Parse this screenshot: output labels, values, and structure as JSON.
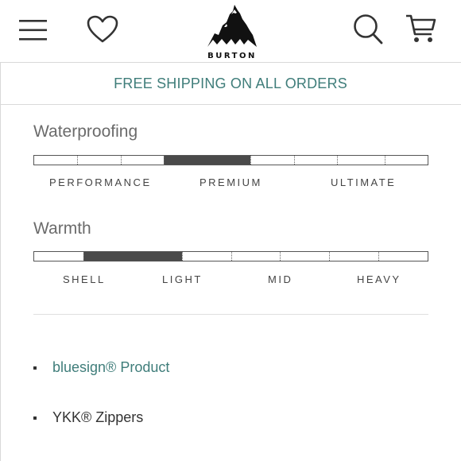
{
  "header": {
    "brand": "BURTON",
    "icons": [
      "menu-icon",
      "heart-icon",
      "burton-mountain-logo",
      "search-icon",
      "cart-icon"
    ]
  },
  "promo": {
    "text": "FREE SHIPPING ON ALL ORDERS",
    "color": "#3f7d7a"
  },
  "ratings": [
    {
      "title": "Waterproofing",
      "levels": [
        "PERFORMANCE",
        "PREMIUM",
        "ULTIMATE"
      ],
      "selected_range": [
        0.33,
        0.55
      ]
    },
    {
      "title": "Warmth",
      "levels": [
        "SHELL",
        "LIGHT",
        "MID",
        "HEAVY"
      ],
      "selected_range": [
        0.125,
        0.375
      ]
    }
  ],
  "features": [
    {
      "label": "bluesign® Product",
      "is_link": true
    },
    {
      "label": "YKK® Zippers",
      "is_link": false
    }
  ]
}
